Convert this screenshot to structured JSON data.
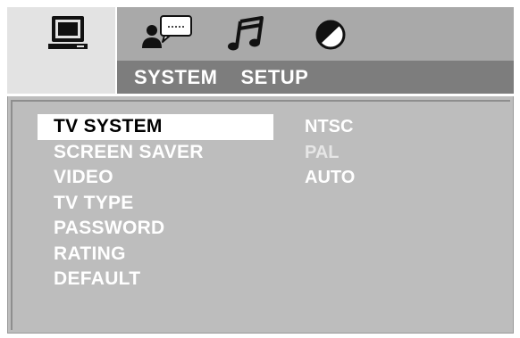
{
  "header": {
    "tabs": [
      {
        "icon": "monitor-icon",
        "active": true
      },
      {
        "icon": "person-speech-icon",
        "active": false
      },
      {
        "icon": "music-note-icon",
        "active": false
      },
      {
        "icon": "rating-disc-icon",
        "active": false
      }
    ],
    "title_part1": "SYSTEM",
    "title_part2": "SETUP"
  },
  "menu": {
    "items": [
      {
        "label": "TV SYSTEM",
        "selected": true
      },
      {
        "label": "SCREEN SAVER",
        "selected": false
      },
      {
        "label": "VIDEO",
        "selected": false
      },
      {
        "label": "TV TYPE",
        "selected": false
      },
      {
        "label": "PASSWORD",
        "selected": false
      },
      {
        "label": "RATING",
        "selected": false
      },
      {
        "label": "DEFAULT",
        "selected": false
      }
    ]
  },
  "options": {
    "items": [
      "NTSC",
      "PAL",
      "AUTO"
    ]
  },
  "colors": {
    "background": "#bdbdbd",
    "icon_bar": "#a9a9a9",
    "title_strip": "#7d7d7d",
    "active_tab": "#e3e3e3",
    "text": "#ffffff",
    "selected_text": "#000000"
  }
}
